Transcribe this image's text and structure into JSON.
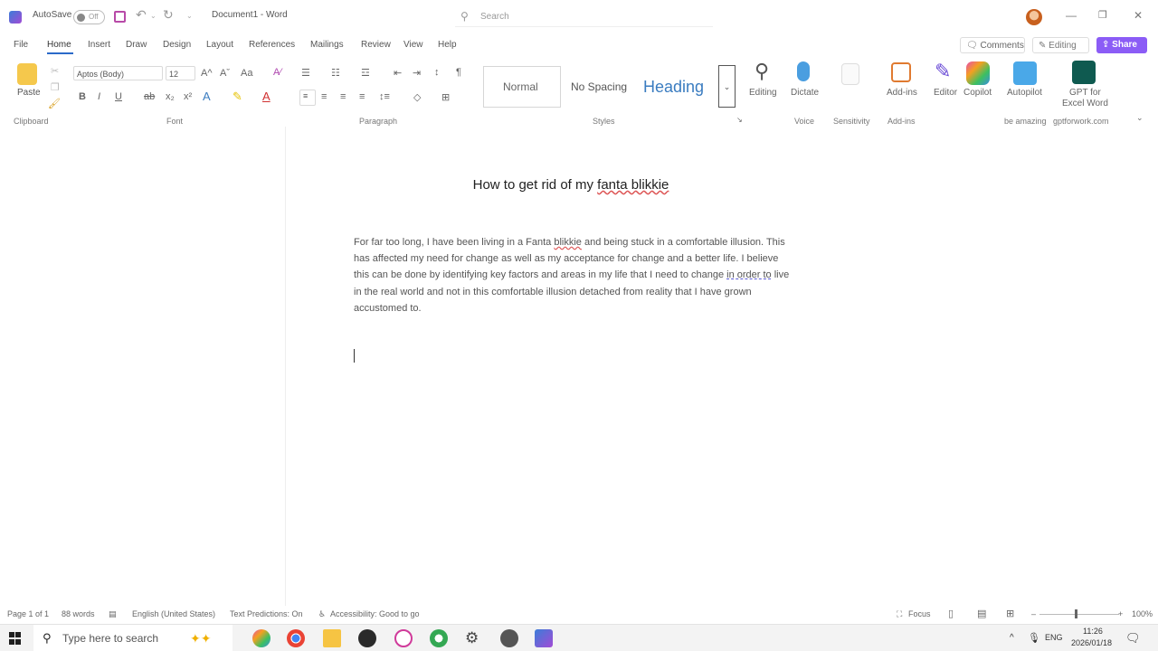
{
  "titlebar": {
    "autosave_label": "AutoSave",
    "autosave_state": "Off",
    "doc_title": "Document1 - Word",
    "search_placeholder": "Search",
    "undo_icon": "undo-icon",
    "redo_icon": "redo-icon"
  },
  "menu": {
    "items": [
      "File",
      "Home",
      "Insert",
      "Draw",
      "Design",
      "Layout",
      "References",
      "Mailings",
      "Review",
      "View",
      "Help"
    ],
    "active": "Home",
    "comments_label": "Comments",
    "editing_label": "Editing",
    "share_label": "Share"
  },
  "ribbon": {
    "clipboard": {
      "paste_label": "Paste",
      "group_label": "Clipboard"
    },
    "font": {
      "font_name": "Aptos (Body)",
      "font_size": "12",
      "group_label": "Font",
      "buttons": [
        "B",
        "I",
        "U",
        "ab",
        "x₂",
        "x²"
      ],
      "grow_font": "A^",
      "shrink_font": "Aˇ",
      "change_case": "Aa"
    },
    "paragraph": {
      "group_label": "Paragraph"
    },
    "styles": {
      "normal": "Normal",
      "no_spacing": "No Spacing",
      "heading": "Heading",
      "group_label": "Styles"
    },
    "editing": {
      "label": "Editing"
    },
    "voice": {
      "dictate_label": "Dictate",
      "group_label": "Voice"
    },
    "sensitivity": {
      "group_label": "Sensitivity"
    },
    "addins": {
      "label": "Add-ins",
      "group_label": "Add-ins"
    },
    "editor": {
      "label": "Editor"
    },
    "copilot": {
      "label": "Copilot"
    },
    "autopilot": {
      "label": "Autopilot",
      "group_label": "be amazing"
    },
    "gpt": {
      "label_line1": "GPT for",
      "label_line2": "Excel Word",
      "group_label": "gptforwork.com"
    }
  },
  "document": {
    "title_prefix": "How to get rid of my ",
    "title_wavy": "fanta blikkie",
    "body": {
      "p1": "For far too long, I have been living in a Fanta ",
      "w1": "blikkie",
      "p2": " and being stuck in a comfortable illusion. This has affected my need for change as well as my acceptance for change and a better life. I believe this can be done by identifying key factors and areas in my life that I need to change ",
      "w2": "in order to",
      "p3": " live in the real world and not in this comfortable illusion detached from reality that I have grown accustomed to."
    }
  },
  "statusbar": {
    "page": "Page 1 of 1",
    "words": "88 words",
    "language": "English (United States)",
    "predictions": "Text Predictions: On",
    "accessibility": "Accessibility: Good to go",
    "focus": "Focus",
    "zoom": "100%"
  },
  "taskbar": {
    "search_placeholder": "Type here to search",
    "lang": "ENG",
    "time": "11:26",
    "date": "2026/01/18"
  },
  "colors": {
    "accent": "#2b6ac9",
    "share": "#8b5cf6",
    "heading_style": "#3a7cc0"
  }
}
